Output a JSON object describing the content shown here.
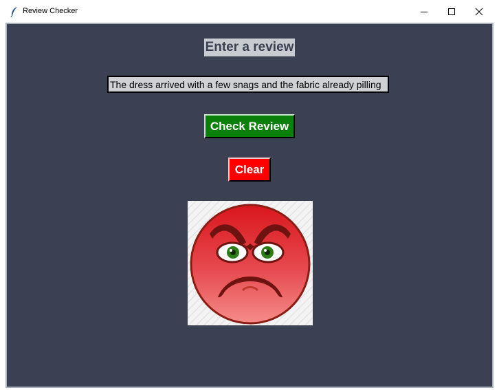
{
  "window": {
    "title": "Review Checker",
    "icon": "feather-icon",
    "controls": {
      "minimize_icon": "minimize-icon",
      "maximize_icon": "maximize-icon",
      "close_icon": "close-icon"
    }
  },
  "form": {
    "heading": "Enter a review",
    "review_value": "The dress arrived with a few snags and the fabric already pilling",
    "check_button": "Check Review",
    "clear_button": "Clear"
  },
  "result": {
    "icon": "angry-face-icon",
    "sentiment_color": "#e0262b"
  },
  "colors": {
    "background": "#3b4052",
    "heading_bg": "#c8cbcf",
    "check_button": "#0a7f0a",
    "clear_button": "#ff0000"
  }
}
